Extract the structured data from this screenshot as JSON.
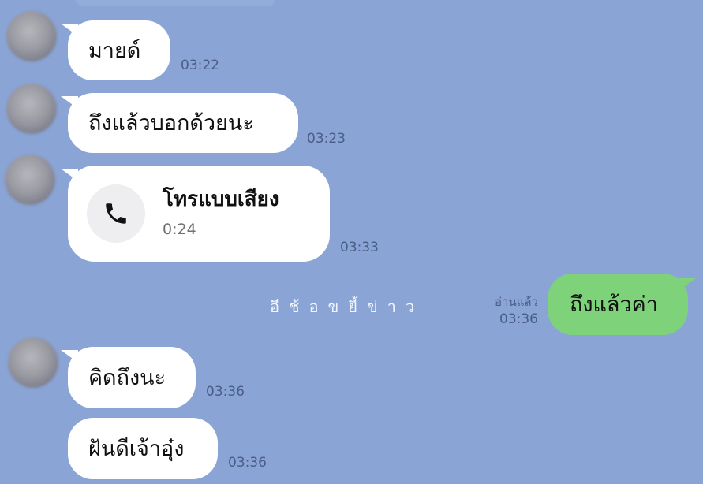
{
  "messages": {
    "m1": {
      "text": "มายด์",
      "time": "03:22"
    },
    "m2": {
      "text": "ถึงแล้วบอกด้วยนะ",
      "time": "03:23"
    },
    "call": {
      "title": "โทรแบบเสียง",
      "duration": "0:24",
      "time": "03:33",
      "icon": "phone-icon"
    },
    "sent": {
      "text": "ถึงแล้วค่า",
      "read": "อ่านแล้ว",
      "time": "03:36"
    },
    "m4": {
      "text": "คิดถึงนะ",
      "time": "03:36"
    },
    "m5": {
      "text": "ฝันดีเจ้าอุ๋ง",
      "time": "03:36"
    }
  },
  "watermark": "อีช้อขยี้ข่าว",
  "colors": {
    "background": "#8aa4d6",
    "incoming_bubble": "#ffffff",
    "outgoing_bubble": "#7ed27a",
    "time": "#4b5d85"
  }
}
